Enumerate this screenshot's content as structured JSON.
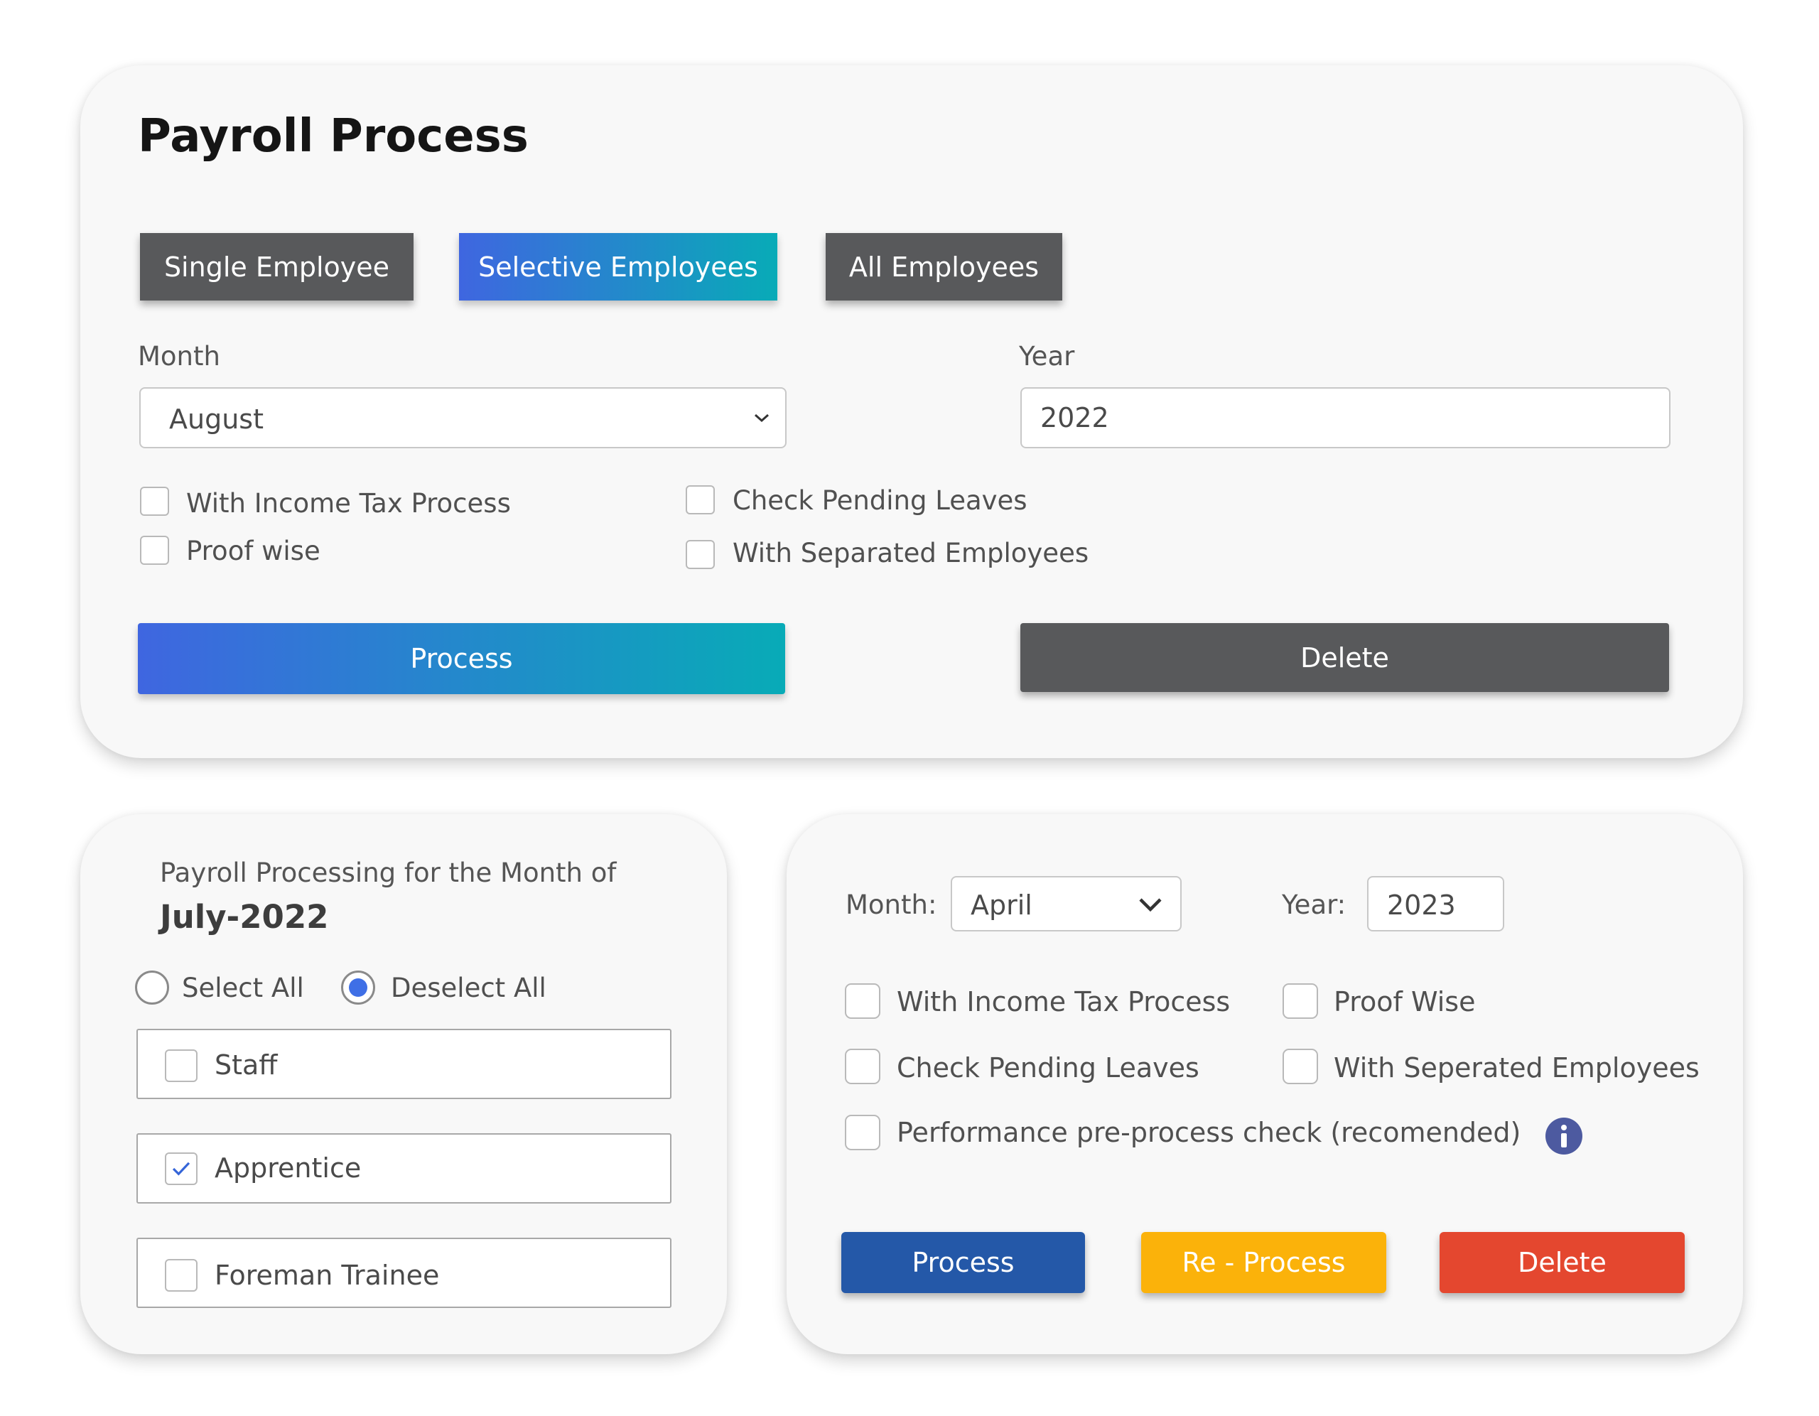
{
  "main": {
    "title": "Payroll Process",
    "tabs": [
      "Single Employee",
      "Selective Employees",
      "All Employees"
    ],
    "active_tab_color": "#08abb7",
    "month_label": "Month",
    "month_value": "August",
    "year_label": "Year",
    "year_value": "2022",
    "options": {
      "income_tax": "With Income Tax Process",
      "proof_wise": "Proof wise",
      "pending_leaves": "Check Pending Leaves",
      "separated": "With Separated Employees"
    },
    "process_label": "Process",
    "delete_label": "Delete"
  },
  "selection": {
    "heading": "Payroll Processing for the Month of",
    "period": "July-2022",
    "select_all": "Select All",
    "deselect_all": "Deselect All",
    "selected_radio": "Deselect All",
    "categories": [
      {
        "label": "Staff",
        "checked": false
      },
      {
        "label": "Apprentice",
        "checked": true
      },
      {
        "label": "Foreman Trainee",
        "checked": false
      }
    ]
  },
  "reprocess": {
    "month_label": "Month:",
    "month_value": "April",
    "year_label": "Year:",
    "year_value": "2023",
    "options": {
      "income_tax": "With Income Tax Process",
      "proof_wise": "Proof Wise",
      "pending_leaves": "Check Pending Leaves",
      "separated": "With Seperated Employees",
      "performance": "Performance pre-process check (recomended)"
    },
    "info_icon": "info-icon",
    "process_label": "Process",
    "reprocess_label": "Re - Process",
    "delete_label": "Delete",
    "colors": {
      "process": "#2458a8",
      "reprocess": "#fbb20a",
      "delete": "#e4472f"
    }
  }
}
